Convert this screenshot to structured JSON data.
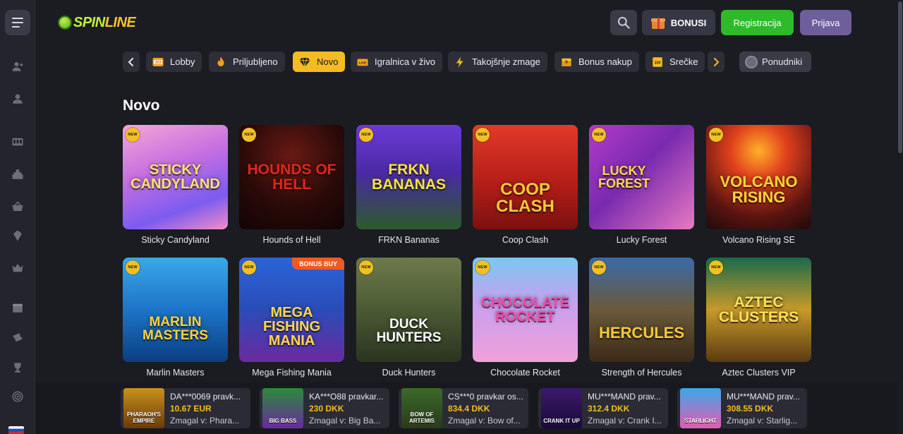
{
  "header": {
    "logo_spin": "SPIN",
    "logo_line": "LINE",
    "bonus_label": "BONUSI",
    "register_label": "Registracija",
    "login_label": "Prijava"
  },
  "categories": [
    {
      "label": "Lobby",
      "icon": "slot-777-icon",
      "active": false
    },
    {
      "label": "Priljubljeno",
      "icon": "flame-icon",
      "active": false
    },
    {
      "label": "Novo",
      "icon": "diamond-icon",
      "active": true
    },
    {
      "label": "Igralnica v živo",
      "icon": "live-icon",
      "active": false
    },
    {
      "label": "Takojšnje zmage",
      "icon": "lightning-icon",
      "active": false
    },
    {
      "label": "Bonus nakup",
      "icon": "chest-icon",
      "active": false
    },
    {
      "label": "Srečke",
      "icon": "ticket-icon",
      "active": false
    }
  ],
  "providers_label": "Ponudniki",
  "section": {
    "title": "Novo",
    "new_badge": "NEW",
    "games": [
      {
        "name": "Sticky Candyland",
        "art": "Sticky Candyland",
        "bonus_buy": false
      },
      {
        "name": "Hounds of Hell",
        "art": "Hounds of Hell",
        "bonus_buy": false
      },
      {
        "name": "FRKN Bananas",
        "art": "FRKN Bananas",
        "bonus_buy": false
      },
      {
        "name": "Coop Clash",
        "art": "Coop Clash",
        "bonus_buy": false
      },
      {
        "name": "Lucky Forest",
        "art": "Lucky Forest",
        "bonus_buy": false
      },
      {
        "name": "Volcano Rising SE",
        "art": "Volcano Rising",
        "bonus_buy": false
      },
      {
        "name": "Marlin Masters",
        "art": "Marlin Masters",
        "bonus_buy": false
      },
      {
        "name": "Mega Fishing Mania",
        "art": "Mega Fishing Mania",
        "bonus_buy": true
      },
      {
        "name": "Duck Hunters",
        "art": "Duck Hunters",
        "bonus_buy": false
      },
      {
        "name": "Chocolate Rocket",
        "art": "Chocolate Rocket",
        "bonus_buy": false
      },
      {
        "name": "Strength of Hercules",
        "art": "Hercules",
        "bonus_buy": false
      },
      {
        "name": "Aztec Clusters VIP",
        "art": "Aztec Clusters",
        "bonus_buy": false
      }
    ],
    "bonus_buy_label": "BONUS BUY"
  },
  "winners": [
    {
      "user": "DA***0069 pravk...",
      "amount": "10.67 EUR",
      "game": "Zmagal v: Phara...",
      "art": "Pharaoh's Empire"
    },
    {
      "user": "KA***O88 pravkar...",
      "amount": "230 DKK",
      "game": "Zmagal v: Big Ba...",
      "art": "Big Bass"
    },
    {
      "user": "CS***0 pravkar os...",
      "amount": "834.4 DKK",
      "game": "Zmagal v: Bow of...",
      "art": "Bow of Artemis"
    },
    {
      "user": "MU***MAND prav...",
      "amount": "312.4 DKK",
      "game": "Zmagal v: Crank I...",
      "art": "Crank It Up"
    },
    {
      "user": "MU***MAND prav...",
      "amount": "308.55 DKK",
      "game": "Zmagal v: Starlig...",
      "art": "Starlight"
    }
  ],
  "colors": {
    "accent": "#f4bc22",
    "register": "#2eba2b",
    "login": "#6f5e9c",
    "background": "#1b1c22"
  }
}
